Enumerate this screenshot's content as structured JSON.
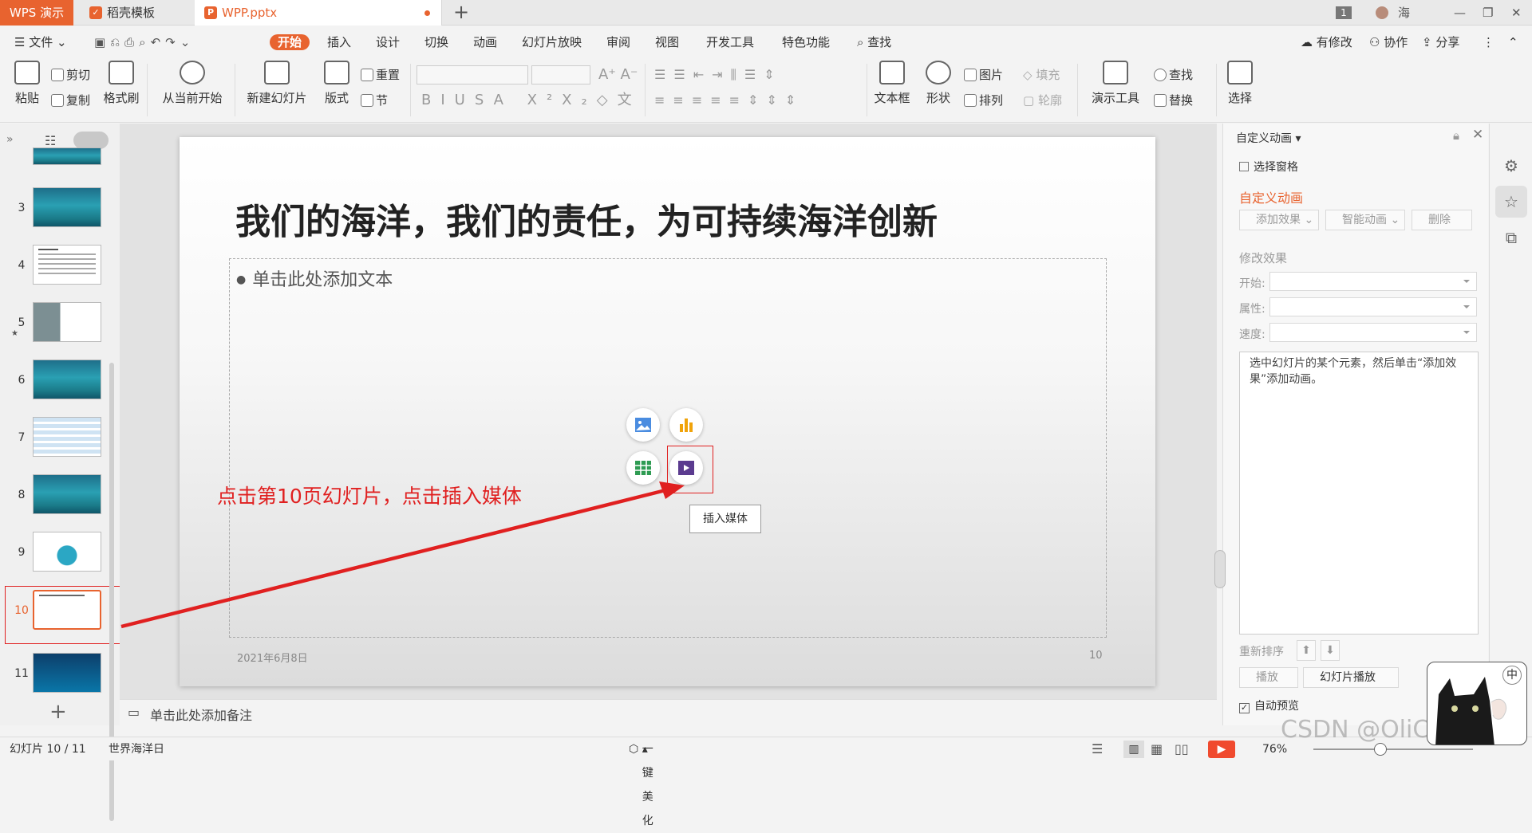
{
  "window": {
    "app_tab": "WPS 演示",
    "tabs": [
      {
        "label": "稻壳模板"
      },
      {
        "label": "WPP.pptx"
      }
    ],
    "badge": "1",
    "user": "海"
  },
  "menu": {
    "file": "文件",
    "items": [
      "开始",
      "插入",
      "设计",
      "切换",
      "动画",
      "幻灯片放映",
      "审阅",
      "视图",
      "开发工具",
      "特色功能"
    ],
    "find": "查找",
    "right": [
      "有修改",
      "协作",
      "分享"
    ]
  },
  "ribbon": {
    "paste": "粘贴",
    "cut": "剪切",
    "copy": "复制",
    "format_painter": "格式刷",
    "from_current": "从当前开始",
    "new_slide": "新建幻灯片",
    "layout": "版式",
    "reset": "重置",
    "section": "节",
    "textbox": "文本框",
    "shape": "形状",
    "picture": "图片",
    "fill": "填充",
    "arrange": "排列",
    "outline": "轮廓",
    "present_tools": "演示工具",
    "find": "查找",
    "replace": "替换",
    "select": "选择"
  },
  "thumbs": [
    "3",
    "4",
    "5",
    "6",
    "7",
    "8",
    "9",
    "10",
    "11"
  ],
  "slide": {
    "title": "我们的海洋，我们的责任，为可持续海洋创新",
    "placeholder": "单击此处添加文本",
    "date": "2021年6月8日",
    "number": "10",
    "tooltip": "插入媒体",
    "annotation": "点击第10页幻灯片，点击插入媒体"
  },
  "notes": "单击此处添加备注",
  "pane": {
    "title": "自定义动画",
    "select_pane": "选择窗格",
    "section": "自定义动画",
    "add_effect": "添加效果",
    "smart_anim": "智能动画",
    "delete": "删除",
    "modify": "修改效果",
    "start": "开始:",
    "property": "属性:",
    "speed": "速度:",
    "hint": "选中幻灯片的某个元素，然后单击“添加效果”添加动画。",
    "reorder": "重新排序",
    "play": "播放",
    "slideshow": "幻灯片播放",
    "autopreview": "自动预览"
  },
  "status": {
    "slide": "幻灯片 10 / 11",
    "theme": "世界海洋日",
    "beautify": "一键美化",
    "zoom": "76%"
  },
  "watermark": "CSDN @OliCorreto",
  "ime": "中"
}
